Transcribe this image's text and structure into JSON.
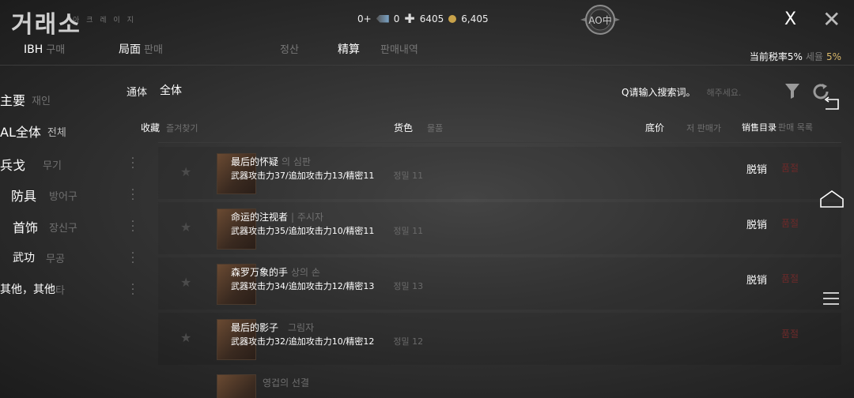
{
  "app": {
    "logo_text": "거래소",
    "logo_sub": "아 크 레 이 지"
  },
  "currency": {
    "a": "0+",
    "b": "0",
    "c": "6405",
    "d": "6,405"
  },
  "emblem_text": "AO中",
  "window": {
    "close_x": "X",
    "close_icon": "✕"
  },
  "tabs": [
    {
      "label": "IBH",
      "ghost": "구매"
    },
    {
      "label": "局面",
      "ghost": "판매"
    },
    {
      "label": "",
      "ghost": "정산"
    },
    {
      "label": "精算",
      "ghost": "판매내역"
    }
  ],
  "tax": {
    "label": "当前税率5%",
    "ghost": "세율",
    "value": "5%"
  },
  "sidebar": [
    {
      "label": "主要",
      "ghost": "재인",
      "menu": false
    },
    {
      "label": "AL全体",
      "ghost": "전체",
      "menu": false
    },
    {
      "label": "兵戈",
      "ghost": "무기",
      "menu": true
    },
    {
      "label": "防具",
      "ghost": "방어구",
      "menu": true
    },
    {
      "label": "首饰",
      "ghost": "장신구",
      "menu": true
    },
    {
      "label": "武功",
      "ghost": "무공",
      "menu": true
    },
    {
      "label": "其他，其他",
      "ghost": "타",
      "menu": true
    }
  ],
  "filter": {
    "label": "通体",
    "value": "全体"
  },
  "search": {
    "placeholder": "Q请输入搜索词。",
    "ghost": "해주세요."
  },
  "headers": {
    "favorite": "收藏",
    "favorite_ghost": "즐겨찾기",
    "goods": "货色",
    "goods_ghost": "물품",
    "price": "底价",
    "price_ghost": "저 판매가",
    "sales": "销售目录",
    "sales_ghost": "판매 목록"
  },
  "rows": [
    {
      "name": "最后的怀疑",
      "name_ghost": "의 심판",
      "stats": "武器攻击力37/追加攻击力13/精密11",
      "stats_ghost": "정밀 11",
      "sold": "脱销",
      "status": "품절"
    },
    {
      "name": "命运的注视者",
      "name_ghost": "| 주시자",
      "stats": "武器攻击力35/追加攻击力10/精密11",
      "stats_ghost": "정밀 11",
      "sold": "脱销",
      "status": "품절"
    },
    {
      "name": "森罗万象的手",
      "name_ghost": "상의 손",
      "stats": "武器攻击力34/追加攻击力12/精密13",
      "stats_ghost": "정밀 13",
      "sold": "脱销",
      "status": "품절"
    },
    {
      "name": "最后的影子",
      "name_ghost": "그림자",
      "stats": "武器攻击力32/追加攻击力10/精密12",
      "stats_ghost": "정밀 12",
      "sold": "",
      "status": "품절"
    },
    {
      "name": "",
      "name_ghost": "영겁의 선결",
      "stats": "",
      "stats_ghost": "",
      "sold": "",
      "status": ""
    }
  ],
  "colors": {
    "accent_gold": "#d9b86a",
    "sold_out_red": "#6e2a2a"
  }
}
